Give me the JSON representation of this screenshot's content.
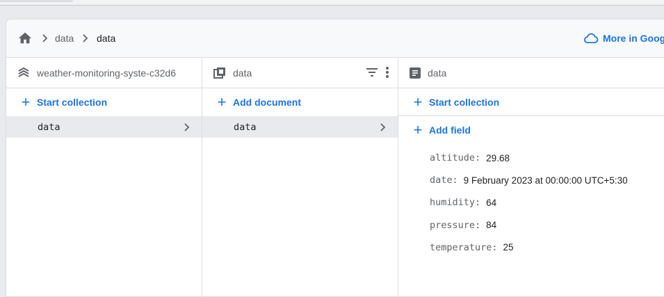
{
  "breadcrumb": {
    "items": [
      "data",
      "data"
    ]
  },
  "header": {
    "more_link": "More in Googl"
  },
  "columns": {
    "root": {
      "title": "weather-monitoring-syste-c32d6",
      "action": "Start collection",
      "selected_item": "data"
    },
    "collection": {
      "title": "data",
      "action": "Add document",
      "selected_item": "data"
    },
    "document": {
      "title": "data",
      "action_collection": "Start collection",
      "action_field": "Add field",
      "fields": [
        {
          "key": "altitude",
          "value": "29.68"
        },
        {
          "key": "date",
          "value": "9 February 2023 at 00:00:00 UTC+5:30"
        },
        {
          "key": "humidity",
          "value": "64"
        },
        {
          "key": "pressure",
          "value": "84"
        },
        {
          "key": "temperature",
          "value": "25"
        }
      ]
    }
  },
  "colors": {
    "accent": "#1a73e8",
    "selected_row": "#e8eaed",
    "muted_text": "#5f6368"
  },
  "icons": [
    "home-icon",
    "chevron-right-icon",
    "cloud-icon",
    "database-icon",
    "collection-icon",
    "filter-icon",
    "more-vert-icon",
    "document-icon"
  ]
}
